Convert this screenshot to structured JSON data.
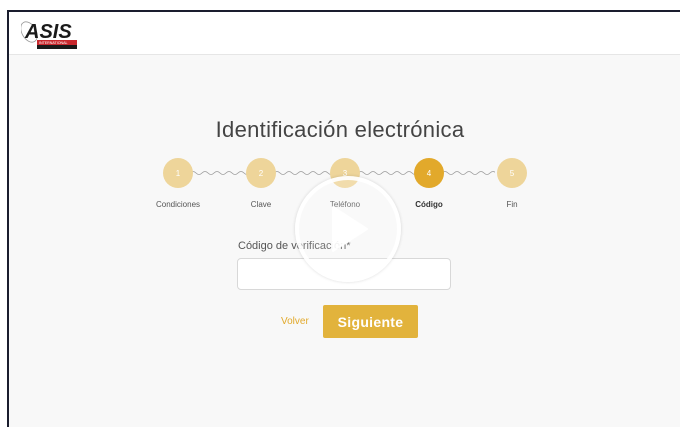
{
  "header": {
    "logo_text": "ASIS",
    "logo_subtext": "INTERNATIONAL"
  },
  "main": {
    "title": "Identificación electrónica",
    "steps": [
      {
        "number": "1",
        "label": "Condiciones",
        "state": "pending"
      },
      {
        "number": "2",
        "label": "Clave",
        "state": "pending"
      },
      {
        "number": "3",
        "label": "Teléfono",
        "state": "pending"
      },
      {
        "number": "4",
        "label": "Código",
        "state": "active"
      },
      {
        "number": "5",
        "label": "Fin",
        "state": "pending"
      }
    ],
    "field_label": "Código de verificación*",
    "field_value": "",
    "back_label": "Volver",
    "next_label": "Siguiente"
  },
  "colors": {
    "accent": "#e2a92b",
    "step_pending": "#eed59a",
    "button": "#e2b33c"
  },
  "overlay": {
    "icon": "play-icon"
  }
}
